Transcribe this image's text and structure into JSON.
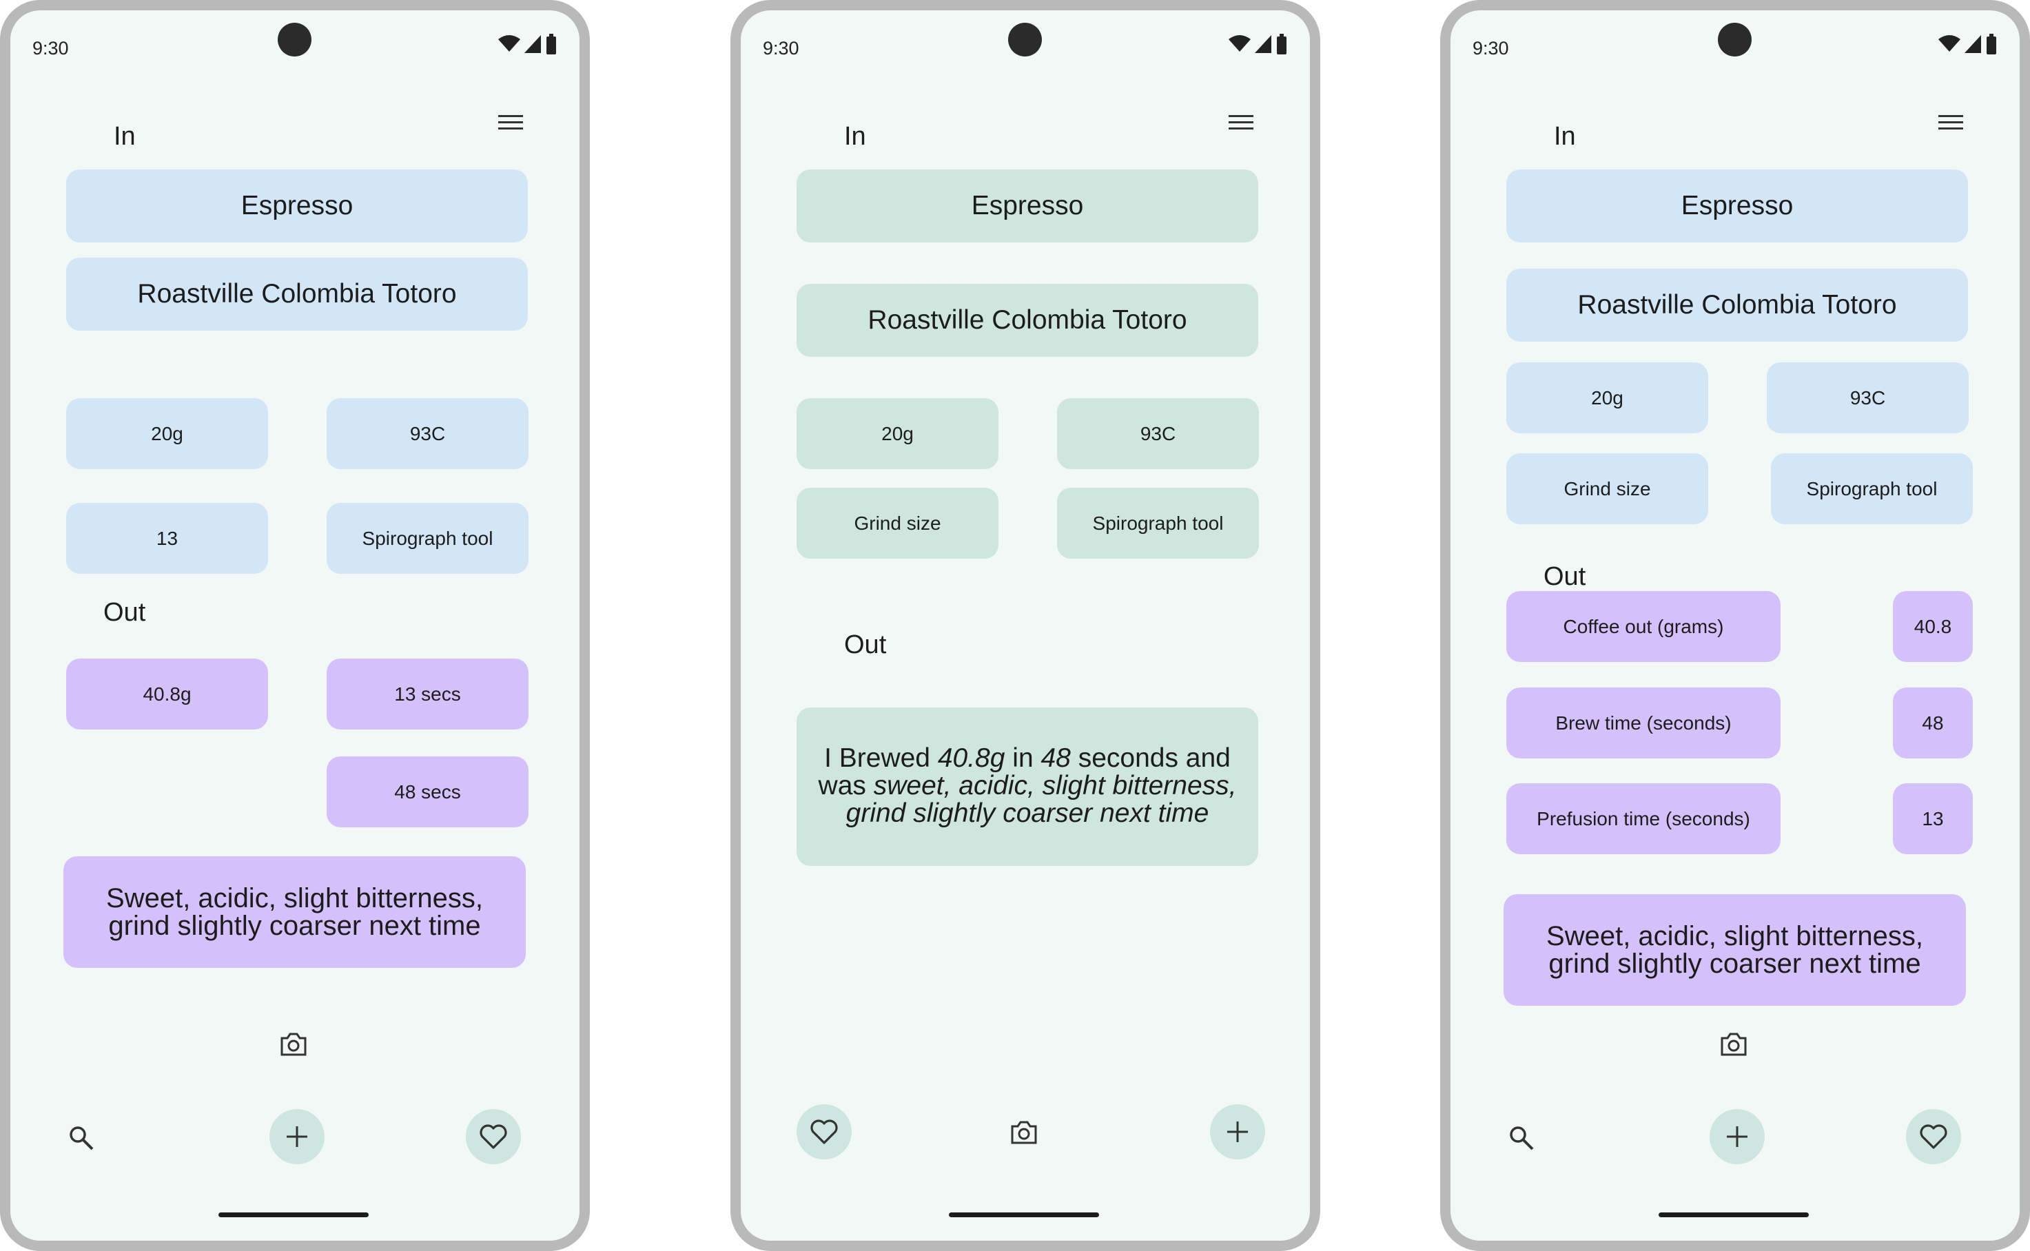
{
  "status": {
    "time": "9:30"
  },
  "screen1": {
    "in_label": "In",
    "method": "Espresso",
    "bean": "Roastville Colombia Totoro",
    "dose": "20g",
    "temp": "93C",
    "grind": "13",
    "tool": "Spirograph tool",
    "out_label": "Out",
    "yield": "40.8g",
    "prefusion": "13 secs",
    "brew_time": "48 secs",
    "notes": "Sweet, acidic, slight bitterness, grind slightly coarser next time"
  },
  "screen2": {
    "in_label": "In",
    "method": "Espresso",
    "bean": "Roastville Colombia Totoro",
    "dose": "20g",
    "temp": "93C",
    "grind": "Grind size",
    "tool": "Spirograph tool",
    "out_label": "Out",
    "sentence": {
      "prefix": "I Brewed ",
      "amount": "40.8g",
      "mid1": " in ",
      "seconds": "48",
      "mid2": " seconds and was ",
      "notes": "sweet, acidic, slight bitterness, grind slightly coarser next time"
    }
  },
  "screen3": {
    "in_label": "In",
    "method": "Espresso",
    "bean": "Roastville Colombia Totoro",
    "dose": "20g",
    "temp": "93C",
    "grind": "Grind size",
    "tool": "Spirograph tool",
    "out_label": "Out",
    "coffee_out_label": "Coffee out (grams)",
    "coffee_out_value": "40.8",
    "brew_time_label": "Brew time (seconds)",
    "brew_time_value": "48",
    "prefusion_label": "Prefusion time (seconds)",
    "prefusion_value": "13",
    "notes": "Sweet, acidic, slight bitterness, grind slightly coarser next time"
  },
  "icons": {
    "menu": "menu-icon",
    "search": "search-icon",
    "add": "plus-icon",
    "favorite": "heart-icon",
    "camera": "camera-icon"
  },
  "colors": {
    "background": "#f2f8f6",
    "in_box_blue": "#d3e6f7",
    "in_box_mint": "#cfe6df",
    "out_box_purple": "#d4c1fb",
    "fab": "#cde6df",
    "frame": "#b9b9b9"
  }
}
